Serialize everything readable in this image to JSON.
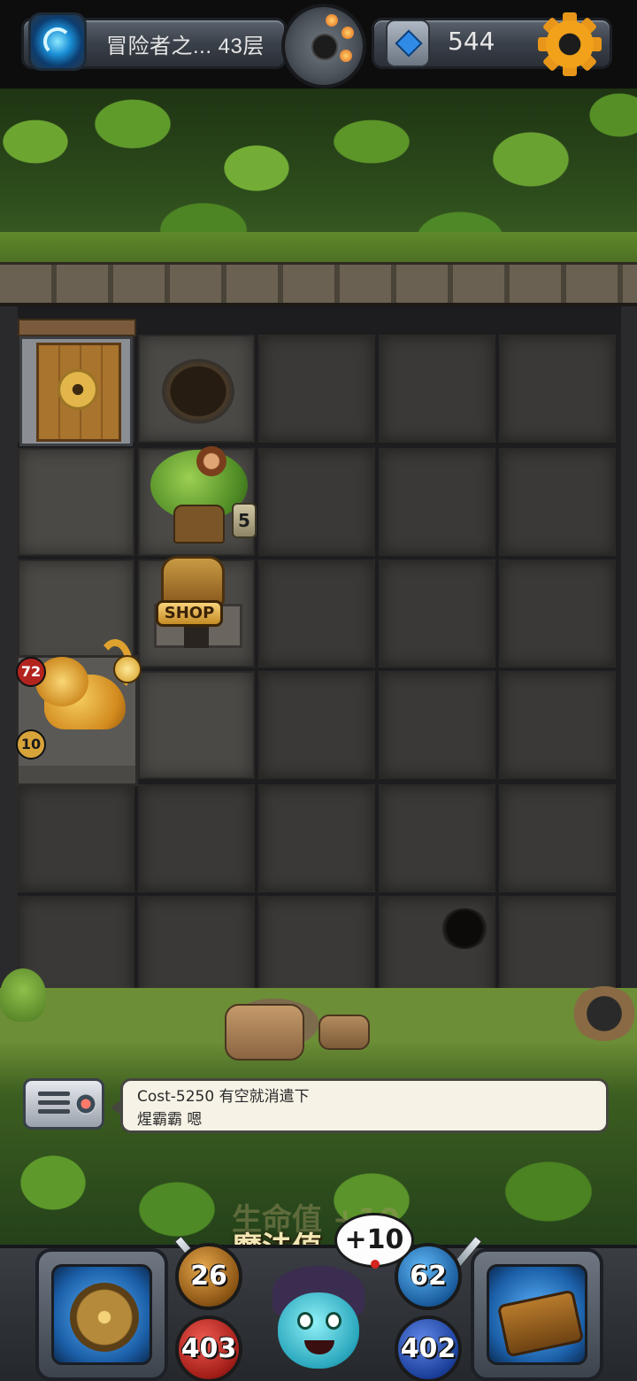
{
  "topbar": {
    "floor_label": "冒险者之... 43层",
    "gem_count": "544",
    "icons": {
      "portal": "portal-icon",
      "bomb": "bomb-icon",
      "gem": "gem-icon",
      "settings": "gear-icon"
    }
  },
  "board": {
    "tree_counter": "5",
    "shop_label": "SHOP",
    "monster": {
      "name": "cat-monster",
      "attack": "72",
      "hp": "10"
    }
  },
  "message": {
    "line1": "Cost-5250 有空就消遣下",
    "line2": "煋霸霸 嗯"
  },
  "floating": {
    "hp_gain": "生命值 +10",
    "mp_label": "魔法值"
  },
  "hud": {
    "attack": "26",
    "hp": "403",
    "defense": "62",
    "mp": "402",
    "bubble_text": "+10"
  },
  "colors": {
    "accent_gold": "#f2a21a",
    "hp_red": "#a11d18",
    "mp_blue": "#1b3f9a"
  }
}
